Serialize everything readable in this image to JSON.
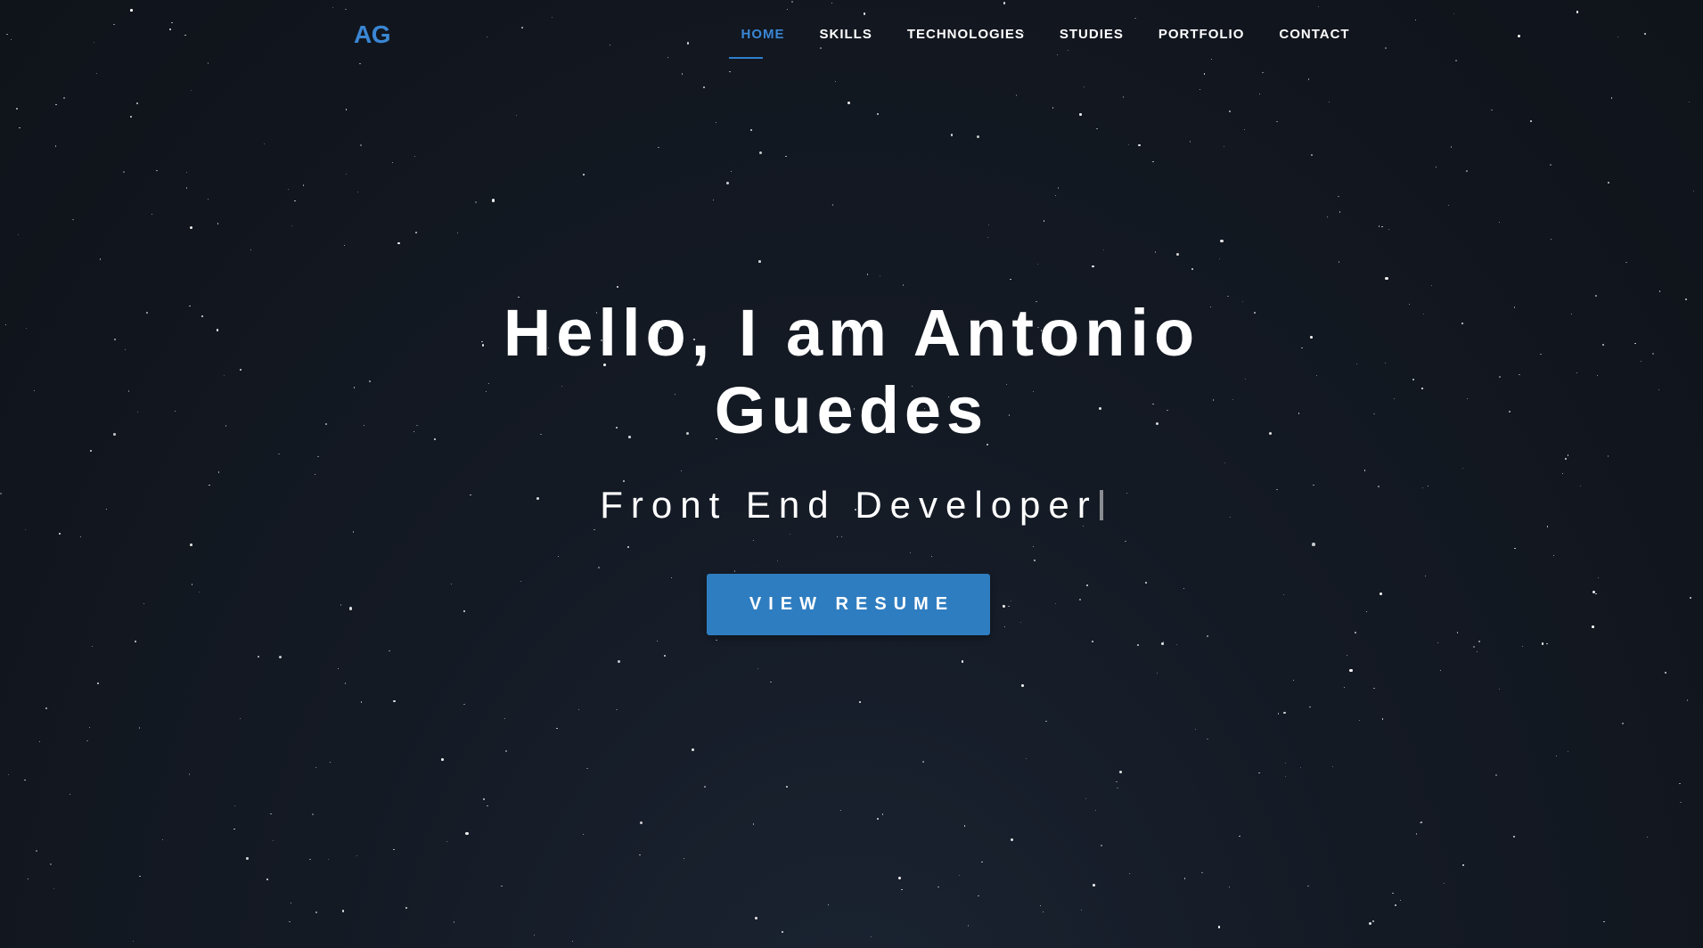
{
  "logo": {
    "text": "AG"
  },
  "nav": {
    "items": [
      {
        "label": "HOME",
        "active": true
      },
      {
        "label": "SKILLS",
        "active": false
      },
      {
        "label": "TECHNOLOGIES",
        "active": false
      },
      {
        "label": "STUDIES",
        "active": false
      },
      {
        "label": "PORTFOLIO",
        "active": false
      },
      {
        "label": "CONTACT",
        "active": false
      }
    ]
  },
  "hero": {
    "title": "Hello, I am Antonio Guedes",
    "subtitle": "Front End Developer",
    "button_label": "VIEW RESUME"
  },
  "colors": {
    "accent": "#2f7dc1",
    "logo": "#3a86d4",
    "background": "#141a24",
    "text": "#ffffff"
  }
}
